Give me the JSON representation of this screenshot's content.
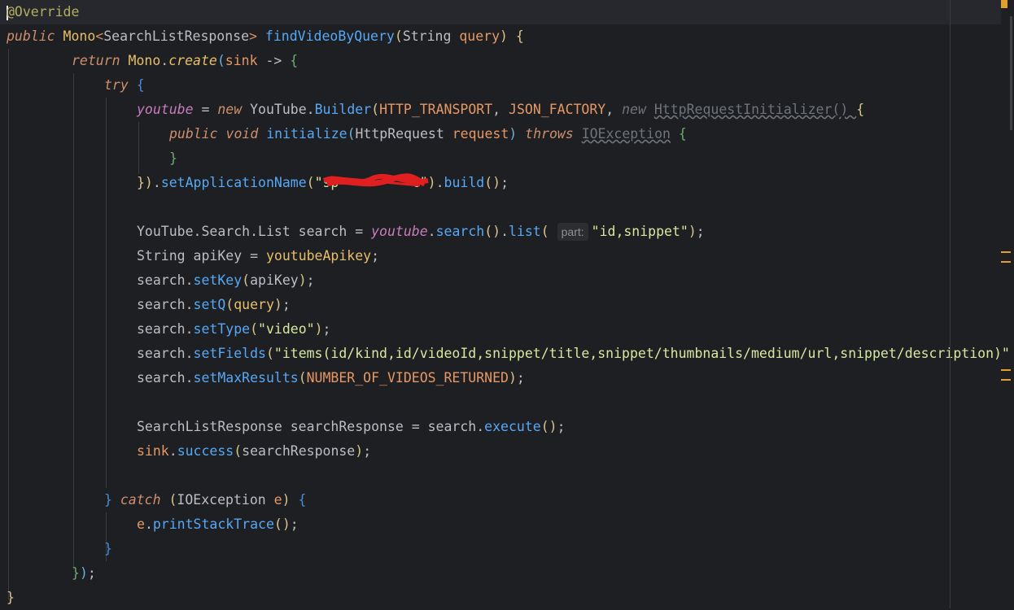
{
  "editor": {
    "lines": [
      {
        "parts": [
          {
            "c": "annot",
            "t": "@Override"
          }
        ]
      },
      {
        "parts": [
          {
            "c": "kw",
            "t": "public "
          },
          {
            "c": "mono",
            "t": "Mono"
          },
          {
            "c": "gen",
            "t": "<"
          },
          {
            "c": "plain",
            "t": "SearchListResponse"
          },
          {
            "c": "gen",
            "t": ">"
          },
          {
            "c": "plain",
            "t": " "
          },
          {
            "c": "fn",
            "t": "findVideoByQuery"
          },
          {
            "c": "paren1",
            "t": "("
          },
          {
            "c": "plain",
            "t": "String "
          },
          {
            "c": "p-orange",
            "t": "query"
          },
          {
            "c": "paren1",
            "t": ")"
          },
          {
            "c": "plain",
            "t": " "
          },
          {
            "c": "paren1",
            "t": "{"
          }
        ]
      },
      {
        "parts": [
          {
            "c": "kw",
            "t": "return "
          },
          {
            "c": "mono",
            "t": "Mono"
          },
          {
            "c": "plain",
            "t": "."
          },
          {
            "c": "static",
            "t": "create"
          },
          {
            "c": "paren2",
            "t": "("
          },
          {
            "c": "p-orange",
            "t": "sink"
          },
          {
            "c": "plain",
            "t": " -> "
          },
          {
            "c": "brace-g",
            "t": "{"
          }
        ]
      },
      {
        "parts": [
          {
            "c": "kw",
            "t": "try "
          },
          {
            "c": "brace-b",
            "t": "{"
          }
        ]
      },
      {
        "parts": [
          {
            "c": "field",
            "t": "youtube"
          },
          {
            "c": "plain",
            "t": " = "
          },
          {
            "c": "kw",
            "t": "new "
          },
          {
            "c": "plain",
            "t": "YouTube."
          },
          {
            "c": "fn",
            "t": "Builder"
          },
          {
            "c": "paren1",
            "t": "("
          },
          {
            "c": "const",
            "t": "HTTP_TRANSPORT"
          },
          {
            "c": "plain",
            "t": ", "
          },
          {
            "c": "const",
            "t": "JSON_FACTORY"
          },
          {
            "c": "plain",
            "t": ", "
          },
          {
            "c": "dim",
            "t": "new "
          },
          {
            "c": "dim-ul",
            "t": "HttpRequestInitializer() "
          },
          {
            "c": "paren1",
            "t": "{"
          }
        ]
      },
      {
        "parts": [
          {
            "c": "kwc",
            "t": "public void "
          },
          {
            "c": "fn",
            "t": "initialize"
          },
          {
            "c": "paren2",
            "t": "("
          },
          {
            "c": "plain",
            "t": "HttpRequest "
          },
          {
            "c": "p-orange",
            "t": "request"
          },
          {
            "c": "paren2",
            "t": ")"
          },
          {
            "c": "plain",
            "t": " "
          },
          {
            "c": "kw",
            "t": "throws "
          },
          {
            "c": "dim-ul",
            "t": "IOException"
          },
          {
            "c": "plain",
            "t": " "
          },
          {
            "c": "brace-g",
            "t": "{"
          }
        ]
      },
      {
        "parts": [
          {
            "c": "brace-g",
            "t": "}"
          }
        ]
      },
      {
        "parts": [
          {
            "c": "paren1",
            "t": "})"
          },
          {
            "c": "plain",
            "t": "."
          },
          {
            "c": "fn",
            "t": "setApplicationName"
          },
          {
            "c": "paren1",
            "t": "("
          },
          {
            "c": "str2",
            "t": "\"sp         t\""
          },
          {
            "c": "paren1",
            "t": ")"
          },
          {
            "c": "plain",
            "t": "."
          },
          {
            "c": "fn",
            "t": "build"
          },
          {
            "c": "paren1",
            "t": "()"
          },
          {
            "c": "plain",
            "t": ";"
          }
        ]
      },
      {
        "parts": []
      },
      {
        "parts": [
          {
            "c": "plain",
            "t": "YouTube.Search.List search = "
          },
          {
            "c": "field",
            "t": "youtube"
          },
          {
            "c": "plain",
            "t": "."
          },
          {
            "c": "fn",
            "t": "search"
          },
          {
            "c": "paren1",
            "t": "()"
          },
          {
            "c": "plain",
            "t": "."
          },
          {
            "c": "fn",
            "t": "list"
          },
          {
            "c": "paren1",
            "t": "( "
          },
          {
            "c": "hint",
            "t": "part:"
          },
          {
            "c": "str2",
            "t": "\"id,snippet\""
          },
          {
            "c": "paren1",
            "t": ")"
          },
          {
            "c": "plain",
            "t": ";"
          }
        ]
      },
      {
        "parts": [
          {
            "c": "plain",
            "t": "String apiKey = "
          },
          {
            "c": "mono",
            "t": "youtubeApikey"
          },
          {
            "c": "plain",
            "t": ";"
          }
        ]
      },
      {
        "parts": [
          {
            "c": "plain",
            "t": "search."
          },
          {
            "c": "fn",
            "t": "setKey"
          },
          {
            "c": "paren1",
            "t": "("
          },
          {
            "c": "plain",
            "t": "apiKey"
          },
          {
            "c": "paren1",
            "t": ")"
          },
          {
            "c": "plain",
            "t": ";"
          }
        ]
      },
      {
        "parts": [
          {
            "c": "plain",
            "t": "search."
          },
          {
            "c": "fn",
            "t": "setQ"
          },
          {
            "c": "paren1",
            "t": "("
          },
          {
            "c": "mono",
            "t": "query"
          },
          {
            "c": "paren1",
            "t": ")"
          },
          {
            "c": "plain",
            "t": ";"
          }
        ]
      },
      {
        "parts": [
          {
            "c": "plain",
            "t": "search."
          },
          {
            "c": "fn",
            "t": "setType"
          },
          {
            "c": "paren1",
            "t": "("
          },
          {
            "c": "str2",
            "t": "\"video\""
          },
          {
            "c": "paren1",
            "t": ")"
          },
          {
            "c": "plain",
            "t": ";"
          }
        ]
      },
      {
        "parts": [
          {
            "c": "plain",
            "t": "search."
          },
          {
            "c": "fn",
            "t": "setFields"
          },
          {
            "c": "paren1",
            "t": "("
          },
          {
            "c": "str2",
            "t": "\"items(id/kind,id/videoId,snippet/title,snippet/thumbnails/medium/url,snippet/description)\""
          }
        ]
      },
      {
        "parts": [
          {
            "c": "plain",
            "t": "search."
          },
          {
            "c": "fn",
            "t": "setMaxResults"
          },
          {
            "c": "paren1",
            "t": "("
          },
          {
            "c": "const",
            "t": "NUMBER_OF_VIDEOS_RETURNED"
          },
          {
            "c": "paren1",
            "t": ")"
          },
          {
            "c": "plain",
            "t": ";"
          }
        ]
      },
      {
        "parts": []
      },
      {
        "parts": [
          {
            "c": "plain",
            "t": "SearchListResponse searchResponse = search."
          },
          {
            "c": "fn",
            "t": "execute"
          },
          {
            "c": "paren1",
            "t": "()"
          },
          {
            "c": "plain",
            "t": ";"
          }
        ]
      },
      {
        "parts": [
          {
            "c": "p-orange",
            "t": "sink"
          },
          {
            "c": "plain",
            "t": "."
          },
          {
            "c": "fn",
            "t": "success"
          },
          {
            "c": "paren1",
            "t": "("
          },
          {
            "c": "plain",
            "t": "searchResponse"
          },
          {
            "c": "paren1",
            "t": ")"
          },
          {
            "c": "plain",
            "t": ";"
          }
        ]
      },
      {
        "parts": []
      },
      {
        "parts": [
          {
            "c": "brace-b",
            "t": "}"
          },
          {
            "c": "plain",
            "t": " "
          },
          {
            "c": "kw",
            "t": "catch "
          },
          {
            "c": "paren1",
            "t": "("
          },
          {
            "c": "plain",
            "t": "IOException "
          },
          {
            "c": "p-orange",
            "t": "e"
          },
          {
            "c": "paren1",
            "t": ")"
          },
          {
            "c": "plain",
            "t": " "
          },
          {
            "c": "brace-b",
            "t": "{"
          }
        ]
      },
      {
        "parts": [
          {
            "c": "p-orange",
            "t": "e"
          },
          {
            "c": "plain",
            "t": "."
          },
          {
            "c": "fn",
            "t": "printStackTrace"
          },
          {
            "c": "paren1",
            "t": "()"
          },
          {
            "c": "plain",
            "t": ";"
          }
        ]
      },
      {
        "parts": [
          {
            "c": "brace-b",
            "t": "}"
          }
        ]
      },
      {
        "parts": [
          {
            "c": "brace-g",
            "t": "}"
          },
          {
            "c": "paren2",
            "t": ")"
          },
          {
            "c": "plain",
            "t": ";"
          }
        ]
      },
      {
        "parts": [
          {
            "c": "paren1",
            "t": "}"
          }
        ]
      }
    ]
  }
}
